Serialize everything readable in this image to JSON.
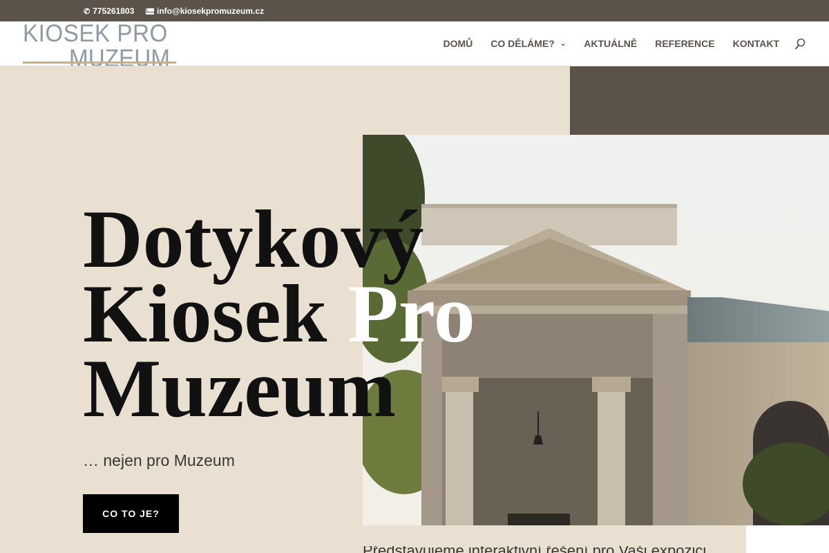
{
  "topbar": {
    "phone": "775261803",
    "email": "info@kiosekpromuzeum.cz"
  },
  "logo": {
    "line1": "KIOSEK PRO",
    "line2": "MUZEUM"
  },
  "nav": {
    "items": [
      {
        "label": "DOMŮ"
      },
      {
        "label": "CO DĚLÁME?",
        "has_dropdown": true
      },
      {
        "label": "AKTUÁLNĚ"
      },
      {
        "label": "REFERENCE"
      },
      {
        "label": "KONTAKT"
      }
    ]
  },
  "hero": {
    "title_line1": "Dotykový",
    "title_line2_a": "Kiosek",
    "title_line2_b": "Pro",
    "title_line3": "Muzeum",
    "subtitle": "… nejen pro Muzeum",
    "cta_label": "CO TO JE?"
  },
  "below": {
    "text": "Představujeme interaktivní řešení pro Vaši expozici"
  },
  "colors": {
    "topbar_bg": "#5b534a",
    "hero_bg": "#e9e0d2",
    "logo_rule": "#c7b27d",
    "cta_bg": "#000000"
  }
}
